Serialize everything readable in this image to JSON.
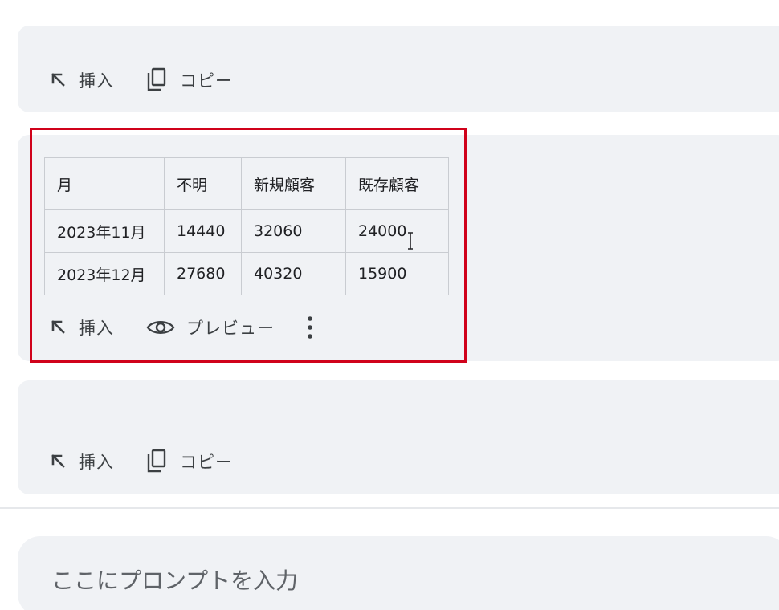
{
  "top_card": {
    "actions": [
      {
        "label": "挿入",
        "icon": "insert-arrow-icon"
      },
      {
        "label": "コピー",
        "icon": "copy-icon"
      }
    ]
  },
  "table_card": {
    "table": {
      "headers": [
        "月",
        "不明",
        "新規顧客",
        "既存顧客"
      ],
      "rows": [
        [
          "2023年11月",
          "14440",
          "32060",
          "24000"
        ],
        [
          "2023年12月",
          "27680",
          "40320",
          "15900"
        ]
      ]
    },
    "actions": [
      {
        "label": "挿入",
        "icon": "insert-arrow-icon"
      },
      {
        "label": "プレビュー",
        "icon": "eye-icon"
      }
    ],
    "more_icon": "more-vert-icon",
    "highlight_color": "#d0021b"
  },
  "bottom_card": {
    "actions": [
      {
        "label": "挿入",
        "icon": "insert-arrow-icon"
      },
      {
        "label": "コピー",
        "icon": "copy-icon"
      }
    ]
  },
  "prompt": {
    "placeholder": "ここにプロンプトを入力",
    "value": ""
  }
}
